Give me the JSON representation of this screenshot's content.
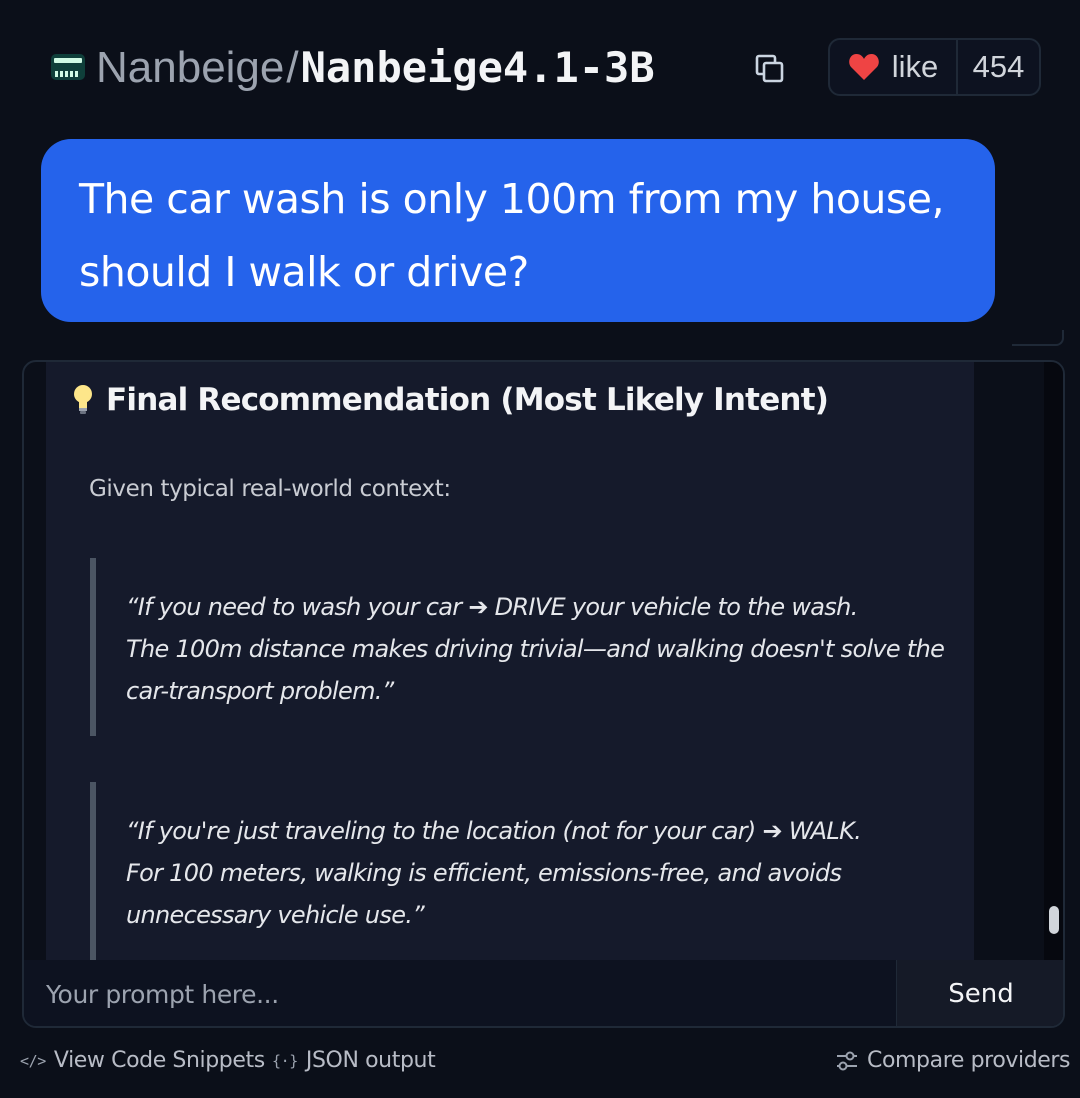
{
  "header": {
    "org": "Nanbeige",
    "separator": "/",
    "model": "Nanbeige4.1-3B",
    "like_label": "like",
    "like_count": "454"
  },
  "chat": {
    "user_message_line1": "The car wash is only 100m from my house,",
    "user_message_line2": "should I walk or drive?",
    "response": {
      "heading": "Final Recommendation (Most Likely Intent)",
      "intro": "Given typical real-world context:",
      "quote1": [
        "“If you need to wash your car ➔ DRIVE your vehicle to the wash.",
        "The 100m distance makes driving trivial—and walking doesn't solve the",
        "car-transport problem.”"
      ],
      "quote2": [
        "“If you're just traveling to the location (not for your car) ➔ WALK.",
        "For 100 meters, walking is efficient, emissions-free, and avoids",
        "unnecessary vehicle use.”"
      ]
    }
  },
  "input": {
    "placeholder": "Your prompt here...",
    "send_label": "Send"
  },
  "footer": {
    "code_glyph": "</>",
    "view_code": "View Code Snippets",
    "json_glyph": "{·}",
    "json_output": "JSON output",
    "compare": "Compare providers"
  },
  "colors": {
    "background": "#0b0f19",
    "user_bubble": "#2563eb",
    "response_bg": "#151a2b",
    "heart": "#ef4444"
  },
  "icons": [
    "model-logo-icon",
    "copy-icon",
    "heart-icon",
    "lightbulb-icon",
    "code-icon",
    "json-icon",
    "sliders-icon"
  ]
}
